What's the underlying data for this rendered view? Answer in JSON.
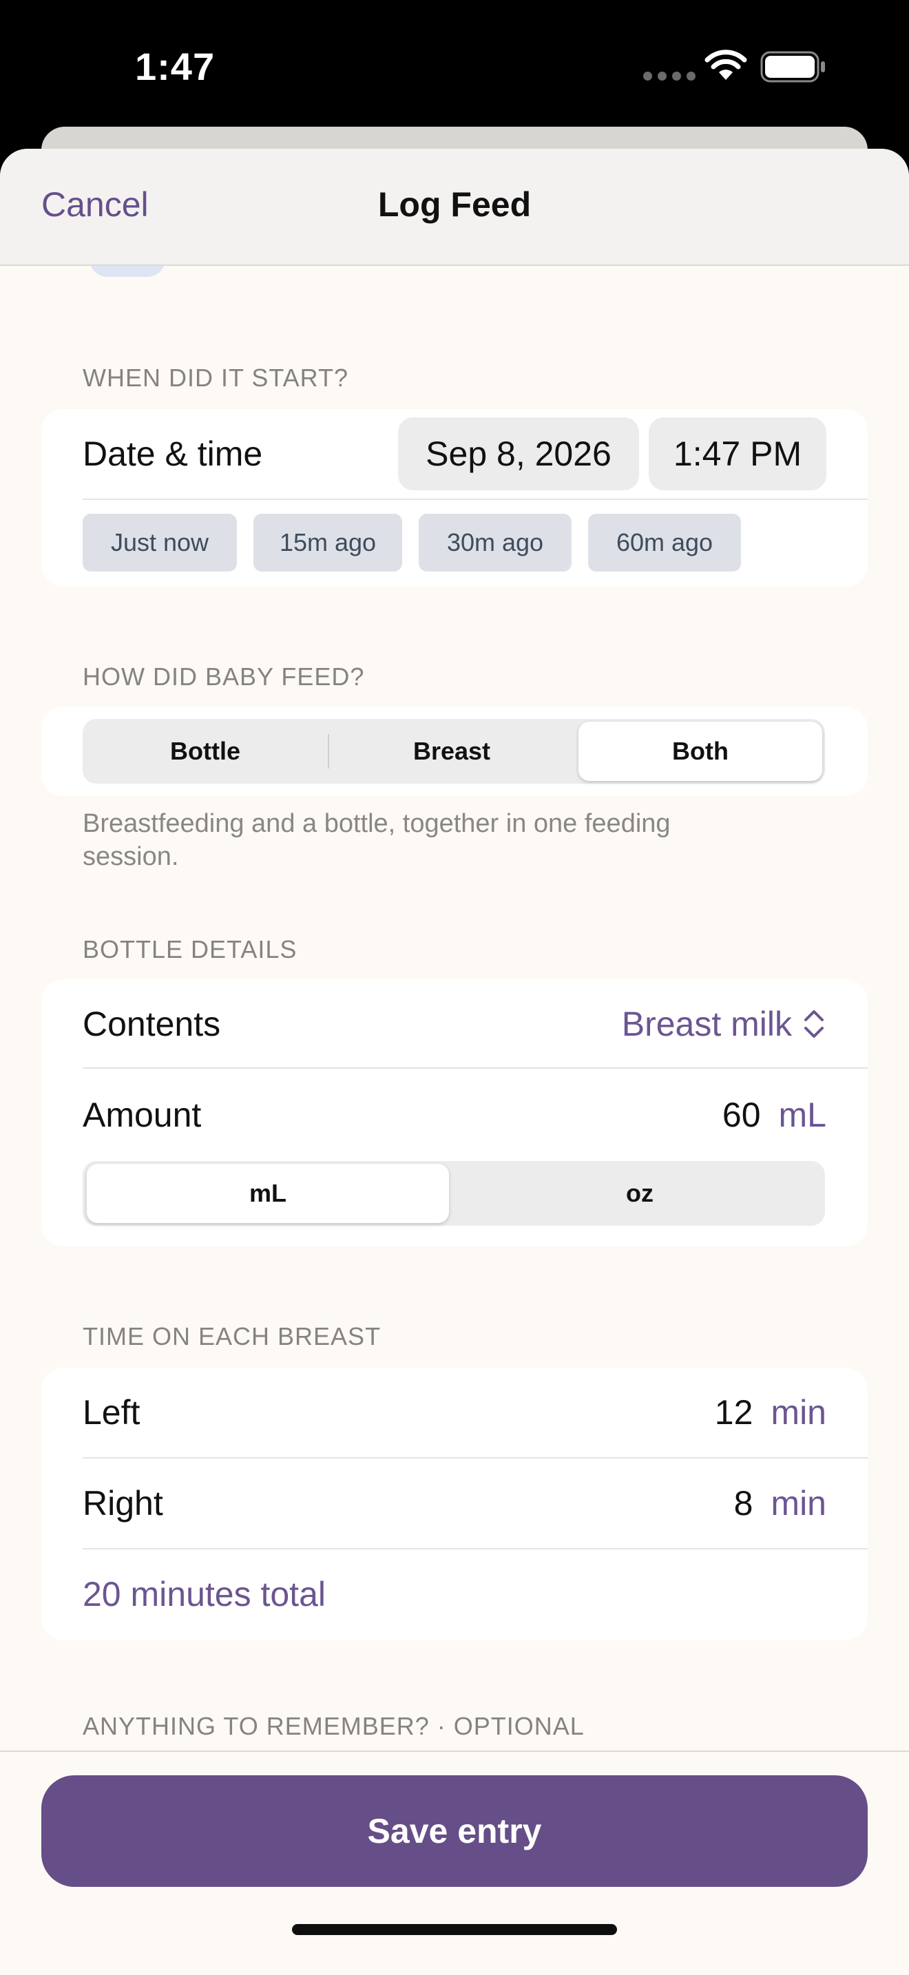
{
  "status_bar": {
    "time": "1:47"
  },
  "nav": {
    "cancel_label": "Cancel",
    "title": "Log Feed"
  },
  "start_section": {
    "header": "WHEN DID IT START?",
    "row_label": "Date & time",
    "date_value": "Sep 8, 2026",
    "time_value": "1:47 PM",
    "quick_chips": [
      "Just now",
      "15m ago",
      "30m ago",
      "60m ago"
    ]
  },
  "feed_type": {
    "header": "HOW DID BABY FEED?",
    "options": [
      "Bottle",
      "Breast",
      "Both"
    ],
    "selected": "Both",
    "description": "Breastfeeding and a bottle, together in one feeding session."
  },
  "bottle_details": {
    "header": "BOTTLE DETAILS",
    "contents_label": "Contents",
    "contents_value": "Breast milk",
    "amount_label": "Amount",
    "amount_value": "60",
    "amount_unit": "mL",
    "unit_options": [
      "mL",
      "oz"
    ],
    "selected_unit": "mL"
  },
  "breast_time": {
    "header": "TIME ON EACH BREAST",
    "left_label": "Left",
    "left_value": "12",
    "left_unit": "min",
    "right_label": "Right",
    "right_value": "8",
    "right_unit": "min",
    "total": "20 minutes total"
  },
  "notes": {
    "header": "ANYTHING TO REMEMBER? · OPTIONAL"
  },
  "footer": {
    "save_label": "Save entry"
  },
  "colors": {
    "accent": "#664e88",
    "accent_text": "#6b5591",
    "background": "#fdfaf5"
  }
}
